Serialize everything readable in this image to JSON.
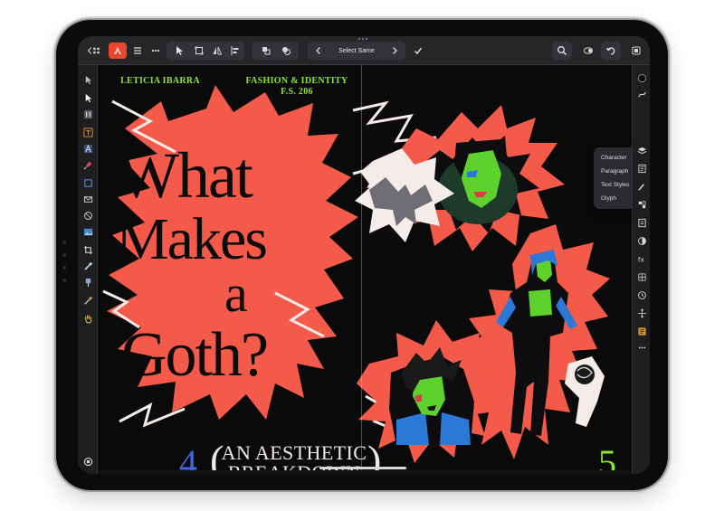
{
  "toolbar": {
    "select_same_label": "Select Same",
    "accent_color": "#ff5a36"
  },
  "document": {
    "author": "LETICIA IBARRA",
    "course_line1": "FASHION & IDENTITY",
    "course_line2": "F.S. 206",
    "title_words": [
      "What",
      "Makes",
      "a",
      "Goth?"
    ],
    "subtitle_line1": "AN AESTHETIC",
    "subtitle_line2": "BREAKDOWN",
    "paren_open": "(",
    "paren_close": ")",
    "page_left": "4",
    "page_right": "5",
    "colors": {
      "background": "#0a0a0a",
      "burst": "#f45a49",
      "header_text": "#8fe33a",
      "page_left": "#3d6ae6",
      "page_right": "#8fe33a"
    }
  },
  "popover": {
    "items": [
      "Character",
      "Paragraph",
      "Text Styles",
      "Glyph"
    ]
  },
  "left_tools": [
    "move-tool-icon",
    "node-tool-icon",
    "artboard-tool-icon",
    "frame-text-tool-icon",
    "artistic-text-tool-icon",
    "pen-tool-icon",
    "shape-tool-icon",
    "rectangle-tool-icon",
    "ellipse-tool-icon",
    "image-frame-tool-icon",
    "crop-tool-icon",
    "fill-tool-icon",
    "transparency-tool-icon",
    "color-picker-tool-icon",
    "hand-tool-icon"
  ],
  "right_panels": [
    "color-panel-icon",
    "stroke-panel-icon",
    "layers-panel-icon",
    "text-styles-panel-icon",
    "brushes-panel-icon",
    "character-panel-icon",
    "swatches-panel-icon",
    "effects-panel-icon",
    "fx-panel-icon",
    "transform-panel-icon",
    "history-panel-icon",
    "navigator-panel-icon",
    "text-panel-icon",
    "more-panels-icon",
    "help-icon"
  ]
}
